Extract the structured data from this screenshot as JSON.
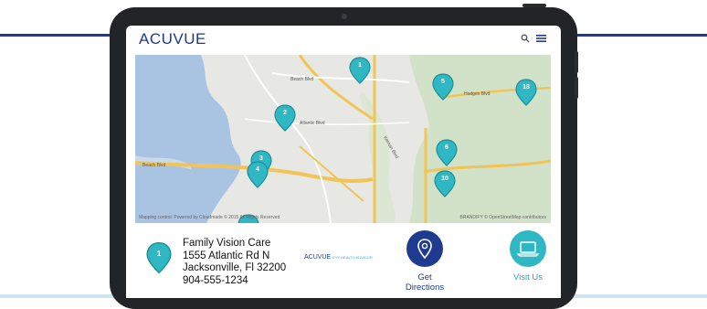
{
  "header": {
    "logo_text": "ACUVUE",
    "search_icon": "search-icon",
    "menu_icon": "hamburger-menu-icon"
  },
  "map": {
    "credit_left": "Mapping control. Powered by  Cloudmade  © 2015 All Rights Reserved",
    "credit_right": "BRANDIFY © OpenStreetMap contributors",
    "road_labels": [
      "Beach Blvd",
      "Beach Blvd",
      "Hodges Blvd",
      "Atlantic Blvd",
      "Kernan Blvd"
    ],
    "pins": [
      {
        "label": "1"
      },
      {
        "label": "2"
      },
      {
        "label": "3"
      },
      {
        "label": "4"
      },
      {
        "label": "5"
      },
      {
        "label": "6"
      },
      {
        "label": "10"
      },
      {
        "label": "18"
      },
      {
        "label": ""
      }
    ],
    "pin_color": "#2fb8c3"
  },
  "location": {
    "pin_label": "1",
    "name": "Family Vision Care",
    "street": "1555 Atlantic Rd N",
    "city_state_zip": "Jacksonville, Fl 32200",
    "phone": "904-555-1234",
    "partner_logo_text": "ACUVUE",
    "partner_logo_sub": "EYE HEALTH ADVISOR"
  },
  "actions": {
    "directions_label": "Get\nDirections",
    "visit_label": "Visit Us",
    "directions_icon": "map-marker-icon",
    "visit_icon": "laptop-icon"
  },
  "colors": {
    "brand_navy": "#1f3b8f",
    "brand_teal": "#2fb8c3"
  }
}
